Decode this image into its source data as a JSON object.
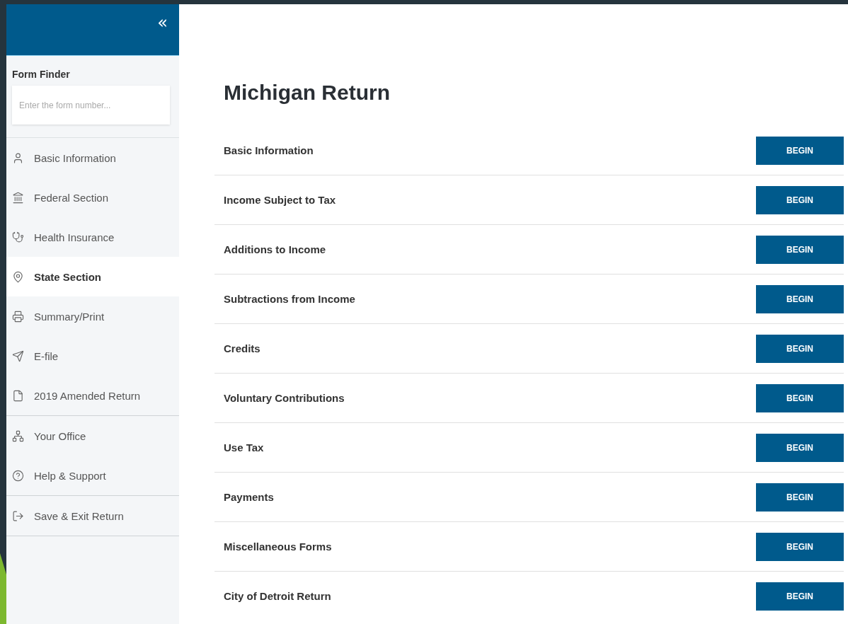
{
  "sidebar": {
    "collapse_label": "«",
    "form_finder": {
      "label": "Form Finder",
      "placeholder": "Enter the form number..."
    },
    "groups": [
      [
        {
          "label": "Basic Information",
          "selected": false
        },
        {
          "label": "Federal Section",
          "selected": false
        },
        {
          "label": "Health Insurance",
          "selected": false
        },
        {
          "label": "State Section",
          "selected": true
        },
        {
          "label": "Summary/Print",
          "selected": false
        },
        {
          "label": "E-file",
          "selected": false
        },
        {
          "label": "2019 Amended Return",
          "selected": false
        }
      ],
      [
        {
          "label": "Your Office",
          "selected": false
        },
        {
          "label": "Help & Support",
          "selected": false
        }
      ],
      [
        {
          "label": "Save & Exit Return",
          "selected": false
        }
      ]
    ]
  },
  "main": {
    "title": "Michigan Return",
    "sections": [
      {
        "label": "Basic Information",
        "button": "BEGIN"
      },
      {
        "label": "Income Subject to Tax",
        "button": "BEGIN"
      },
      {
        "label": "Additions to Income",
        "button": "BEGIN"
      },
      {
        "label": "Subtractions from Income",
        "button": "BEGIN"
      },
      {
        "label": "Credits",
        "button": "BEGIN"
      },
      {
        "label": "Voluntary Contributions",
        "button": "BEGIN"
      },
      {
        "label": "Use Tax",
        "button": "BEGIN"
      },
      {
        "label": "Payments",
        "button": "BEGIN"
      },
      {
        "label": "Miscellaneous Forms",
        "button": "BEGIN"
      },
      {
        "label": "City of Detroit Return",
        "button": "BEGIN"
      }
    ]
  }
}
